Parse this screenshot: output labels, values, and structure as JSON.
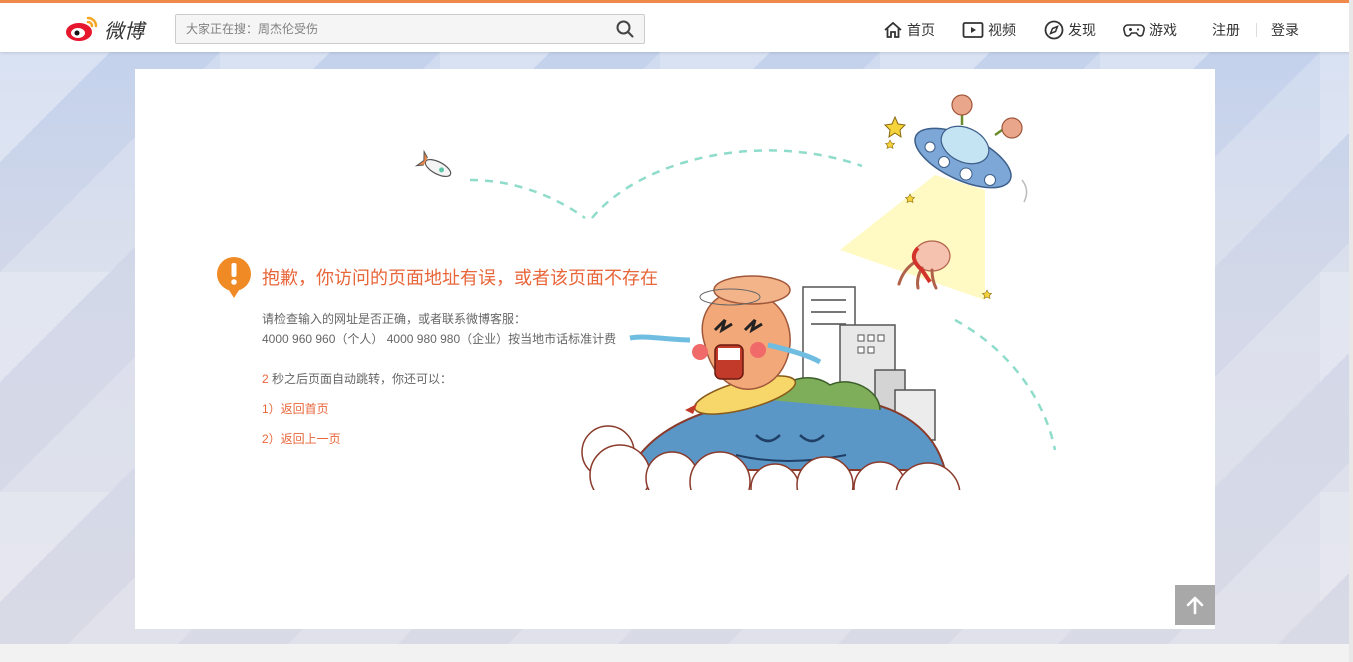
{
  "brand": {
    "name": "微博"
  },
  "search": {
    "placeholder": "大家正在搜：周杰伦受伤"
  },
  "nav": {
    "home": "首页",
    "video": "视频",
    "discover": "发现",
    "games": "游戏",
    "register": "注册",
    "login": "登录"
  },
  "error": {
    "title": "抱歉，你访问的页面地址有误，或者该页面不存在",
    "hint": "请检查输入的网址是否正确，或者联系微博客服：",
    "phones": "4000 960 960（个人） 4000 980 980（企业）按当地市话标准计费",
    "countdown": "2",
    "redirect_text": " 秒之后页面自动跳转，你还可以：",
    "link_home": "1）返回首页",
    "link_back": "2）返回上一页"
  },
  "colors": {
    "accent": "#e8663a",
    "topline": "#f08a4b",
    "warning": "#f08a24"
  },
  "icons": [
    "weibo-logo-icon",
    "search-icon",
    "home-icon",
    "video-icon",
    "discover-icon",
    "game-icon",
    "warning-icon",
    "back-to-top-icon"
  ]
}
